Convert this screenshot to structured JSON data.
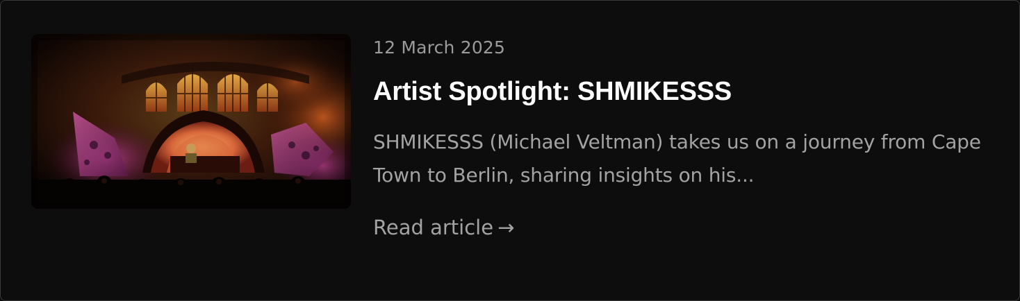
{
  "article": {
    "date": "12 March 2025",
    "title": "Artist Spotlight: SHMIKESSS",
    "excerpt": "SHMIKESSS (Michael Veltman) takes us on a journey from Cape Town to Berlin, sharing insights on his...",
    "read_more_label": "Read article",
    "read_more_arrow": "→"
  },
  "thumbnail": {
    "subject": "festival-stage-photo"
  },
  "colors": {
    "background": "#0d0d0d",
    "border": "#3a3a3a",
    "title": "#ffffff",
    "muted_text": "#a3a3a3"
  }
}
